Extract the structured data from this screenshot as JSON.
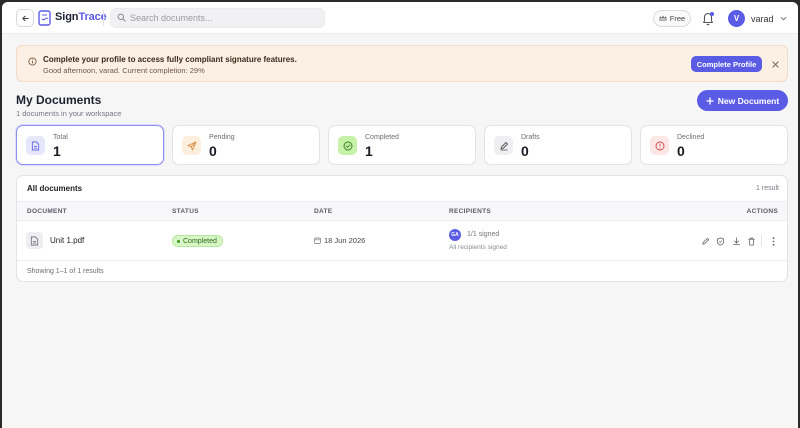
{
  "header": {
    "brand_part1": "Sign",
    "brand_part2": "Trace",
    "search_placeholder": "Search documents...",
    "plan_label": "Free",
    "user_initial": "V",
    "user_name": "varad",
    "accent_color": "#5b5ce6"
  },
  "banner": {
    "title": "Complete your profile to access fully compliant signature features.",
    "subtitle": "Good afternoon, varad. Current completion: 29%",
    "completion_percent": 29,
    "button_label": "Complete Profile"
  },
  "page": {
    "title": "My Documents",
    "subtitle": "1 documents in your workspace",
    "new_button_label": "New Document"
  },
  "stats": [
    {
      "label": "Total",
      "value": "1",
      "icon": "document-icon",
      "active": true
    },
    {
      "label": "Pending",
      "value": "0",
      "icon": "send-icon",
      "active": false
    },
    {
      "label": "Completed",
      "value": "1",
      "icon": "check-circle-icon",
      "active": false
    },
    {
      "label": "Drafts",
      "value": "0",
      "icon": "pencil-icon",
      "active": false
    },
    {
      "label": "Declined",
      "value": "0",
      "icon": "alert-circle-icon",
      "active": false
    }
  ],
  "documents": {
    "title": "All documents",
    "result_count": "1 result",
    "columns": [
      "DOCUMENT",
      "STATUS",
      "DATE",
      "RECIPIENTS",
      "ACTIONS"
    ],
    "rows": [
      {
        "name": "Unit 1.pdf",
        "status": "Completed",
        "date": "18 Jun 2026",
        "recipient_initials": "GA",
        "signed": "1/1 signed",
        "recipients_note": "All recipients signed"
      }
    ],
    "footer": "Showing 1–1 of 1 results"
  }
}
